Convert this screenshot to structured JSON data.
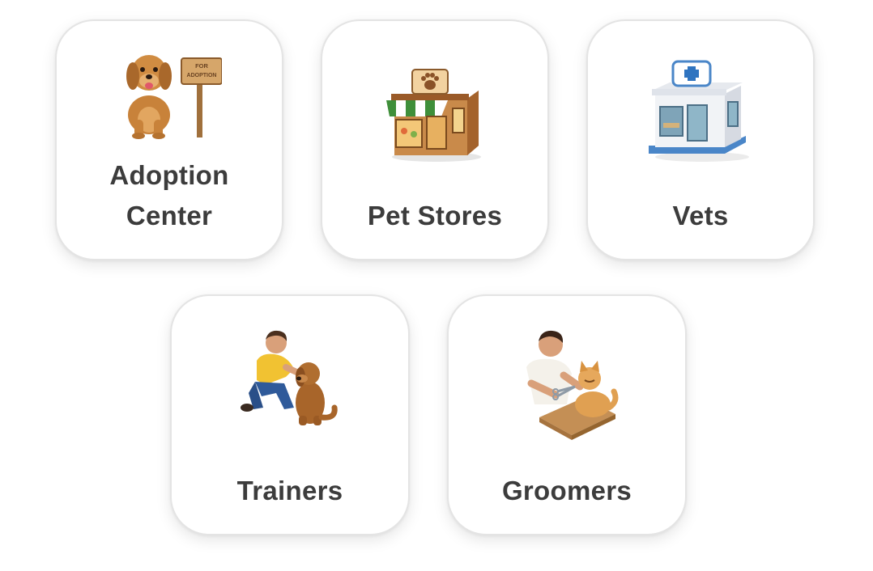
{
  "categories": [
    {
      "id": "adoption",
      "label_lines": [
        "Adoption",
        "Center"
      ],
      "icon": "dog-adoption-sign-icon",
      "sign_lines": [
        "FOR",
        "ADOPTION"
      ]
    },
    {
      "id": "stores",
      "label": "Pet Stores",
      "icon": "pet-store-icon"
    },
    {
      "id": "vets",
      "label": "Vets",
      "icon": "vet-clinic-icon"
    },
    {
      "id": "trainers",
      "label": "Trainers",
      "icon": "trainer-with-dog-icon"
    },
    {
      "id": "groomers",
      "label": "Groomers",
      "icon": "groomer-with-cat-icon"
    }
  ],
  "colors": {
    "card_background": "#ffffff",
    "card_border": "#e4e4e4",
    "label_text": "#3c3c3c"
  }
}
